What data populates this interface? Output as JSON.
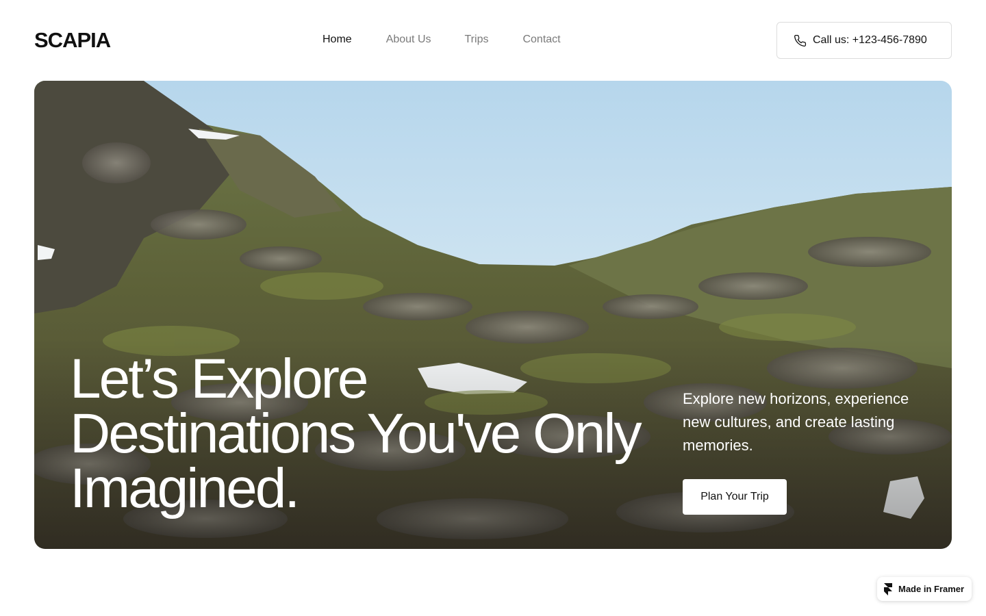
{
  "brand": {
    "logo": "SCAPIA"
  },
  "nav": {
    "items": [
      {
        "label": "Home",
        "active": true
      },
      {
        "label": "About Us",
        "active": false
      },
      {
        "label": "Trips",
        "active": false
      },
      {
        "label": "Contact",
        "active": false
      }
    ]
  },
  "header": {
    "call_label": "Call us: +123-456-7890",
    "call_icon": "phone-icon"
  },
  "hero": {
    "title_lines": [
      "Let’s Explore",
      "Destinations You've Only",
      "Imagined."
    ],
    "subtitle": "Explore new horizons, experience new cultures, and create lasting memories.",
    "cta_label": "Plan Your Trip",
    "image": "mountain-valley-photo"
  },
  "badge": {
    "label": "Made in Framer",
    "icon": "framer-icon"
  },
  "colors": {
    "text": "#111111",
    "muted": "#7a7a7a",
    "border": "#dcdcdc",
    "hero_text": "#ffffff"
  }
}
